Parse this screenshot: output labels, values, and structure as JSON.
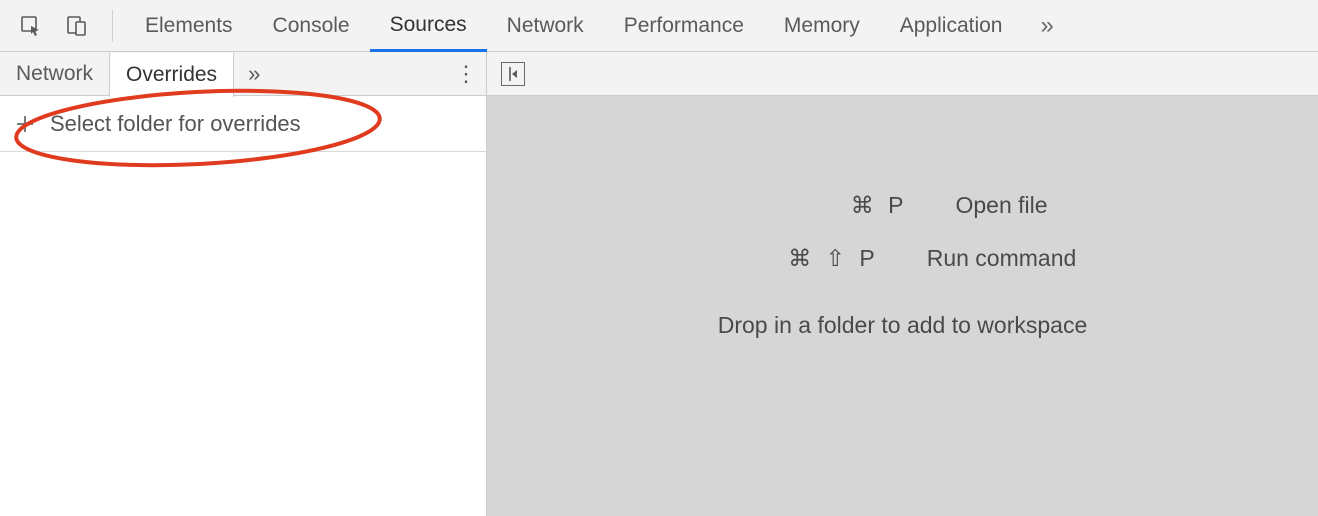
{
  "toolbar": {
    "tabs": [
      "Elements",
      "Console",
      "Sources",
      "Network",
      "Performance",
      "Memory",
      "Application"
    ],
    "active_index": 2
  },
  "sidebar": {
    "tabs": [
      "Network",
      "Overrides"
    ],
    "active_index": 1,
    "select_folder_label": "Select folder for overrides"
  },
  "main": {
    "hints": [
      {
        "keys": "⌘ P",
        "label": "Open file"
      },
      {
        "keys": "⌘ ⇧ P",
        "label": "Run command"
      }
    ],
    "drop_text": "Drop in a folder to add to workspace"
  }
}
